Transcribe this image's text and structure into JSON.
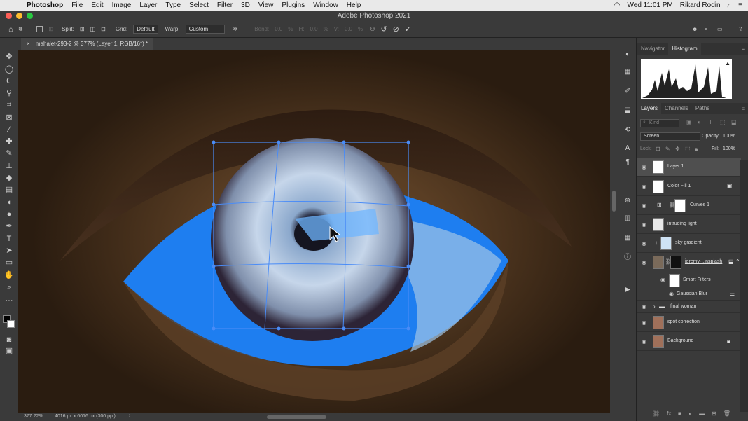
{
  "menubar": {
    "apple": "",
    "app": "Photoshop",
    "items": [
      "File",
      "Edit",
      "Image",
      "Layer",
      "Type",
      "Select",
      "Filter",
      "3D",
      "View",
      "Plugins",
      "Window",
      "Help"
    ],
    "clock": "Wed 11:01 PM",
    "user": "Rikard Rodin"
  },
  "window": {
    "title": "Adobe Photoshop 2021"
  },
  "options": {
    "split_label": "Split:",
    "grid_label": "Grid:",
    "grid_value": "Default",
    "warp_label": "Warp:",
    "warp_value": "Custom",
    "bend_label": "Bend:",
    "bend_value": "0.0",
    "h_label": "H:",
    "h_value": "0.0",
    "v_label": "V:",
    "v_value": "0.0",
    "pct": "%"
  },
  "document": {
    "tab": "mahalet-293-2 @ 377% (Layer 1, RGB/16*) *",
    "zoom": "377.22%",
    "dims": "4016 px x 6016 px (300 ppi)"
  },
  "panels": {
    "top_tabs": [
      "Navigator",
      "Histogram"
    ],
    "layer_tabs": [
      "Layers",
      "Channels",
      "Paths"
    ],
    "kind_placeholder": "Kind",
    "blend_mode": "Screen",
    "opacity_label": "Opacity:",
    "opacity": "100%",
    "lock_label": "Lock:",
    "fill_label": "Fill:",
    "fill": "100%",
    "layers": [
      {
        "name": "Layer 1"
      },
      {
        "name": "Color Fill 1"
      },
      {
        "name": "Curves 1"
      },
      {
        "name": "intruding light"
      },
      {
        "name": "sky gradient"
      },
      {
        "name": "jeremy-...nsplash"
      },
      {
        "name": "Smart Filters"
      },
      {
        "name": "Gaussian Blur"
      },
      {
        "name": "final woman"
      },
      {
        "name": "spot correction"
      },
      {
        "name": "Background"
      }
    ]
  },
  "colors": {
    "accent_blue": "#4a8cf7",
    "iris": "#9ab6d8",
    "sclera_blue": "#1e7ef0"
  }
}
